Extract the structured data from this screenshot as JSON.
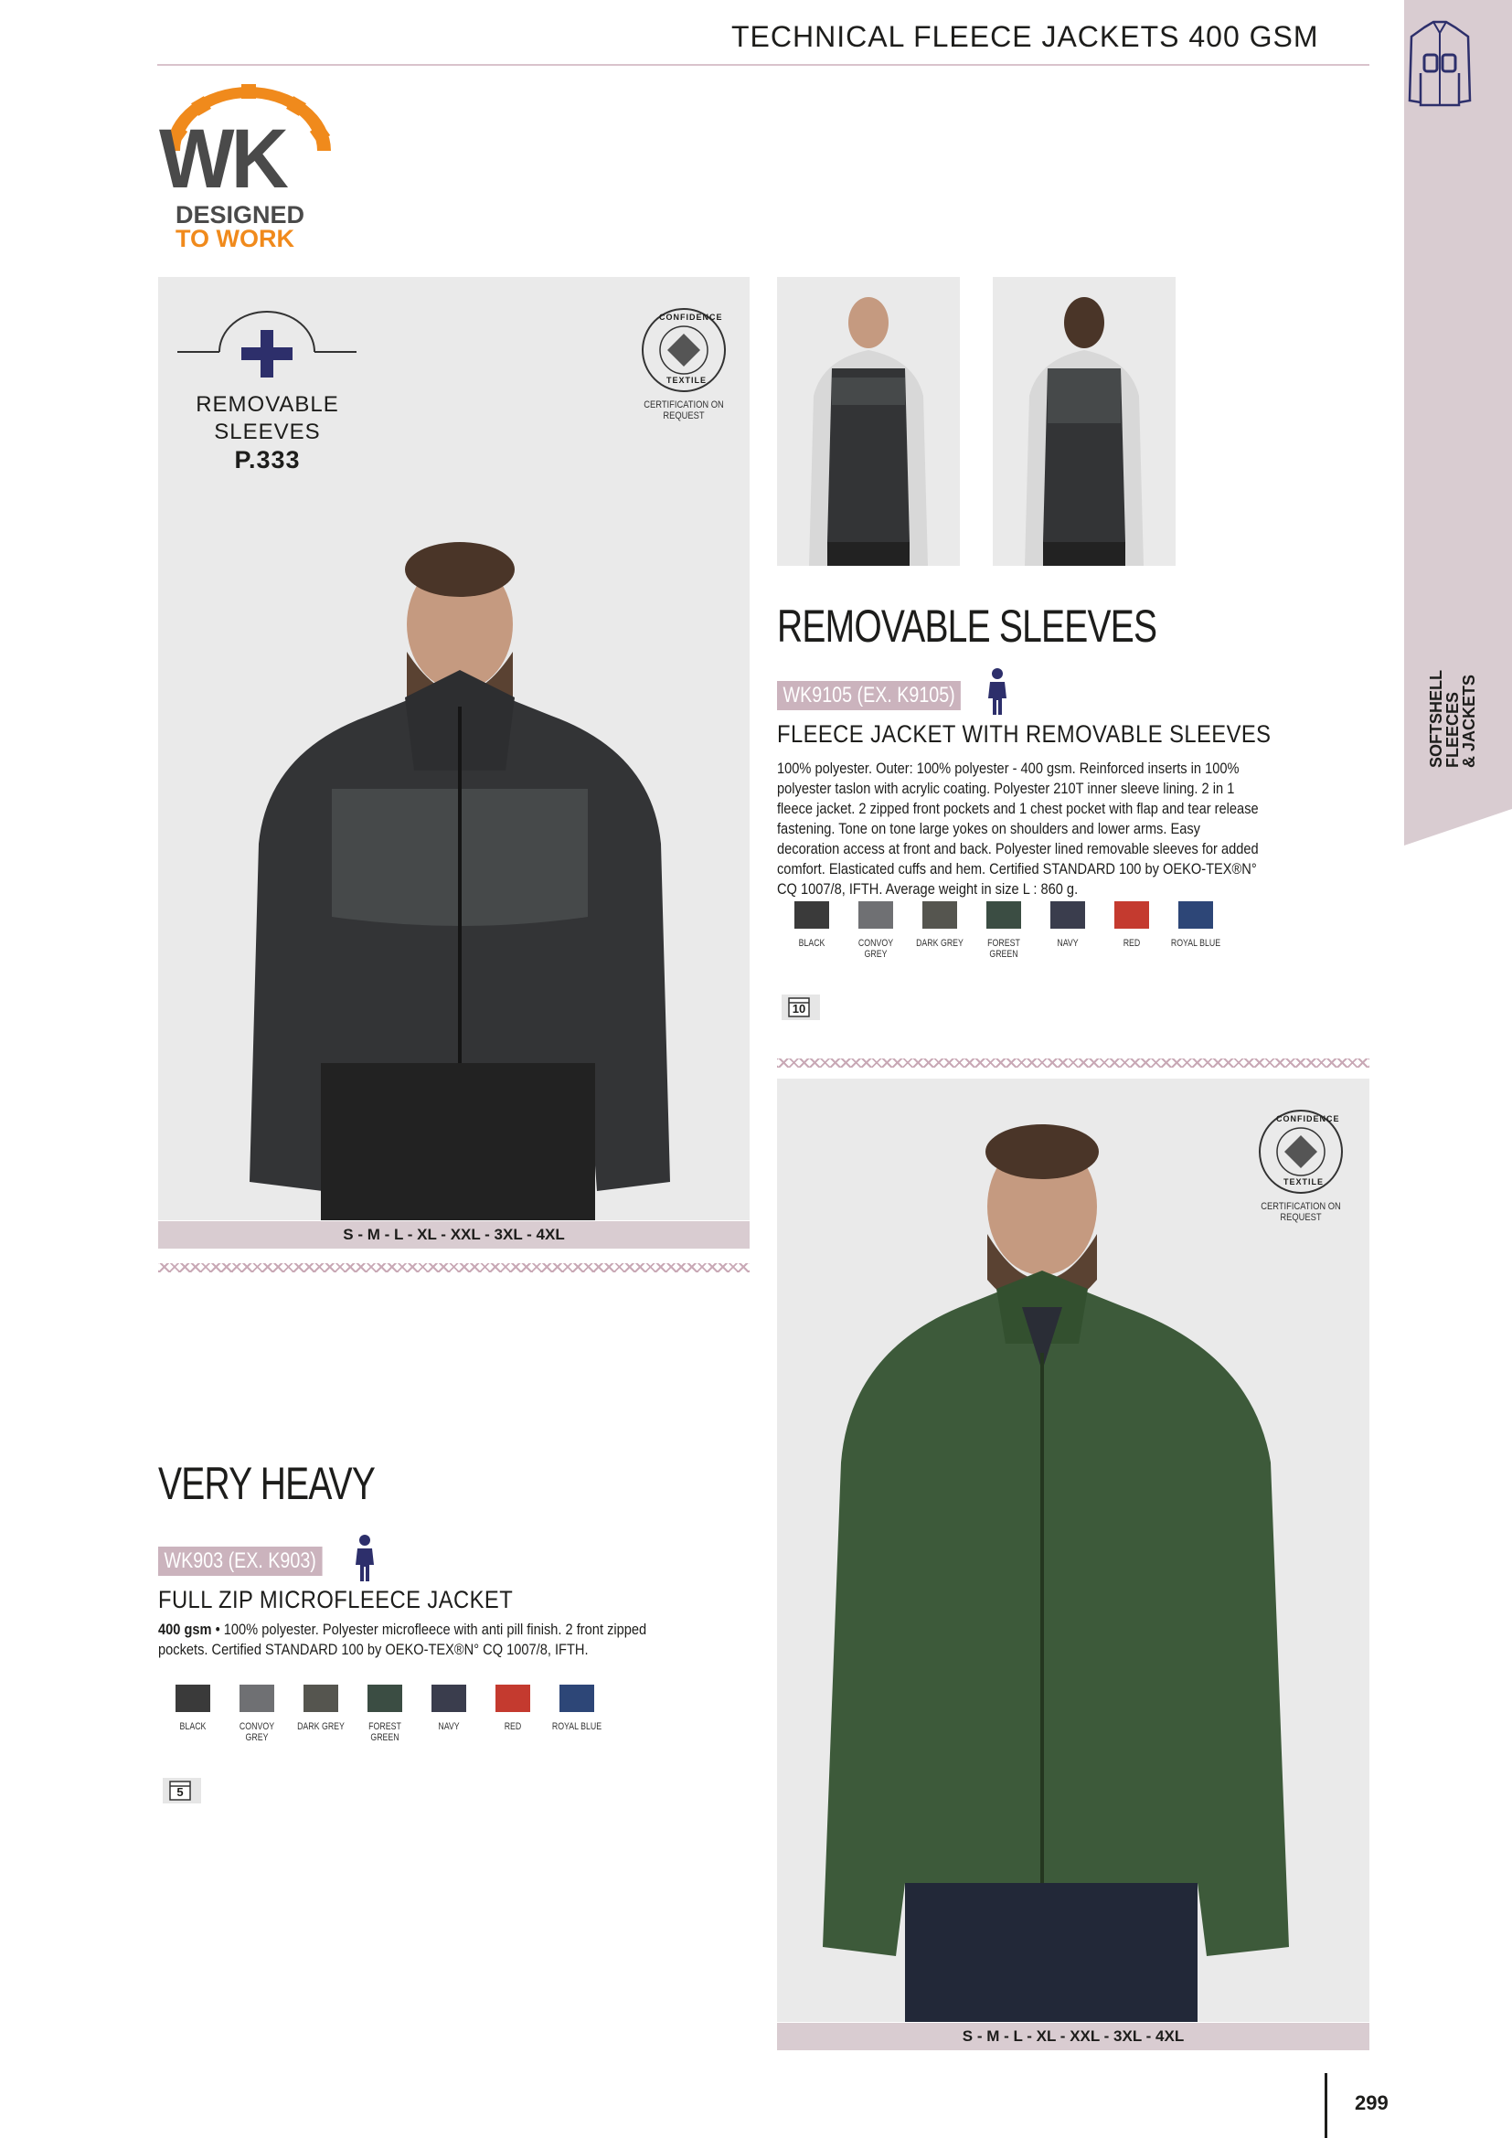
{
  "header": {
    "title": "TECHNICAL FLEECE JACKETS 400 GSM"
  },
  "side_tab": {
    "line1": "SOFTSHELL",
    "line2": "FLEECES",
    "line3": "& JACKETS"
  },
  "logo": {
    "brand": "WK",
    "tagline1": "DESIGNED",
    "tagline2": "TO WORK"
  },
  "removable_badge": {
    "line1": "REMOVABLE",
    "line2": "SLEEVES",
    "page_ref": "P.333"
  },
  "cert": {
    "seal_top": "CONFIDENCE",
    "seal_bottom": "TEXTILE",
    "note": "CERTIFICATION ON REQUEST"
  },
  "product1": {
    "section_title": "REMOVABLE SLEEVES",
    "ref": "WK9105 (EX. K9105)",
    "name": "FLEECE JACKET WITH REMOVABLE SLEEVES",
    "description": "100% polyester. Outer: 100% polyester - 400 gsm.  Reinforced inserts in 100% polyester taslon with acrylic coating. Polyester 210T inner sleeve lining. 2 in 1 fleece jacket. 2 zipped front pockets and 1 chest pocket with flap and tear release fastening. Tone on tone large yokes on shoulders and lower arms. Easy decoration access at front and back. Polyester lined removable sleeves for added comfort. Elasticated cuffs and hem. Certified STANDARD 100 by OEKO-TEX®N° CQ 1007/8, IFTH. Average weight in size L : 860 g.",
    "sizes": "S - M - L - XL - XXL - 3XL - 4XL",
    "pack": "10",
    "colors": [
      {
        "name": "BLACK",
        "hex": "#3a3a3a"
      },
      {
        "name": "CONVOY GREY",
        "hex": "#6f7073"
      },
      {
        "name": "DARK GREY",
        "hex": "#55554f"
      },
      {
        "name": "FOREST GREEN",
        "hex": "#3b4d43"
      },
      {
        "name": "NAVY",
        "hex": "#3a3d4d"
      },
      {
        "name": "RED",
        "hex": "#c43a2f"
      },
      {
        "name": "ROYAL BLUE",
        "hex": "#2d4677"
      }
    ]
  },
  "product2": {
    "section_title": "VERY HEAVY",
    "ref": "WK903 (EX. K903)",
    "name": "FULL ZIP MICROFLEECE JACKET",
    "weight": "400 gsm",
    "description": " • 100% polyester. Polyester microfleece with anti pill finish. 2 front zipped pockets. Certified STANDARD 100 by OEKO-TEX®N° CQ 1007/8, IFTH.",
    "sizes": "S - M - L - XL - XXL - 3XL - 4XL",
    "pack": "5",
    "colors": [
      {
        "name": "BLACK",
        "hex": "#3a3a3a"
      },
      {
        "name": "CONVOY GREY",
        "hex": "#6f7073"
      },
      {
        "name": "DARK GREY",
        "hex": "#55554f"
      },
      {
        "name": "FOREST GREEN",
        "hex": "#3b4d43"
      },
      {
        "name": "NAVY",
        "hex": "#3a3d4d"
      },
      {
        "name": "RED",
        "hex": "#c43a2f"
      },
      {
        "name": "ROYAL BLUE",
        "hex": "#2d4677"
      }
    ]
  },
  "page_number": "299"
}
